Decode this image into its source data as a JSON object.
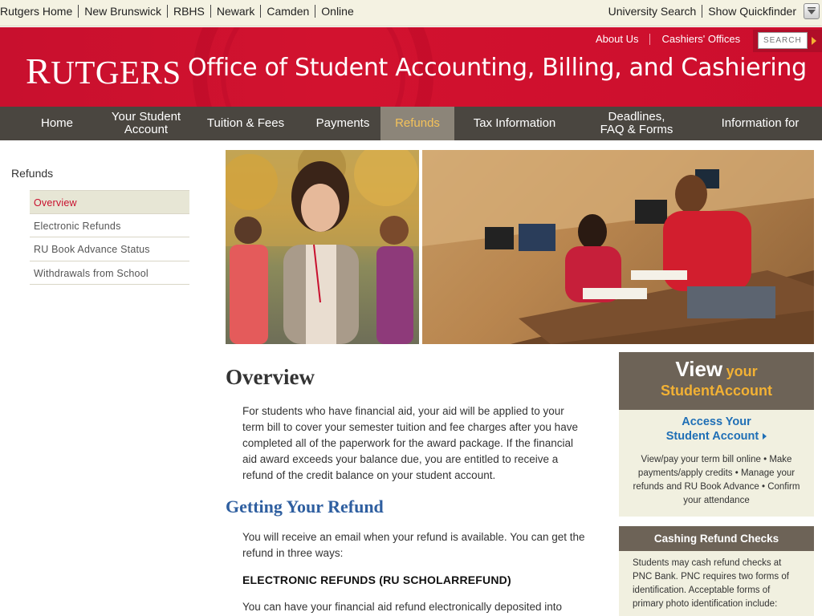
{
  "utility": {
    "left_links": [
      "Rutgers Home",
      "New Brunswick",
      "RBHS",
      "Newark",
      "Camden",
      "Online"
    ],
    "right_links": [
      "University Search",
      "Show Quickfinder"
    ]
  },
  "header": {
    "logo_first": "R",
    "logo_rest": "UTGERS",
    "title": "Office of Student Accounting, Billing, and Cashiering",
    "links": [
      "About Us",
      "Cashiers' Offices"
    ],
    "search_placeholder": "SEARCH",
    "brand_color": "#cc0e2d"
  },
  "nav": {
    "items": [
      "Home",
      "Your Student Account",
      "Tuition & Fees",
      "Payments",
      "Refunds",
      "Tax Information",
      "Deadlines, FAQ & Forms",
      "Information for"
    ],
    "active": "Refunds"
  },
  "sidebar": {
    "title": "Refunds",
    "items": [
      "Overview",
      "Electronic Refunds",
      "RU Book Advance Status",
      "Withdrawals from School"
    ],
    "active": "Overview"
  },
  "main": {
    "heading": "Overview",
    "intro": "For students who have financial aid, your aid will be applied to your term bill to cover your semester tuition and fee charges after you have completed all of the paperwork for the award package. If the financial aid award exceeds your balance due, you are entitled to receive a refund of the credit balance on your student account.",
    "subheading": "Getting Your Refund",
    "refund_intro": "You will receive an email when your refund is available. You can get the refund in three ways:",
    "electronic_heading": "ELECTRONIC REFUNDS (RU SCHOLARREFUND)",
    "electronic_text": "You can have your financial aid refund electronically deposited into"
  },
  "promo": {
    "view": "View",
    "your": "your",
    "student": "Student",
    "account": "Account",
    "access_line1": "Access Your",
    "access_line2": "Student Account",
    "description": "View/pay your term bill online • Make payments/apply credits • Manage your refunds and RU Book Advance • Confirm your attendance"
  },
  "cashing": {
    "title": "Cashing Refund Checks",
    "text": "Students may cash refund checks at PNC Bank. PNC requires two forms of identification. Acceptable forms of primary photo identification include:"
  }
}
